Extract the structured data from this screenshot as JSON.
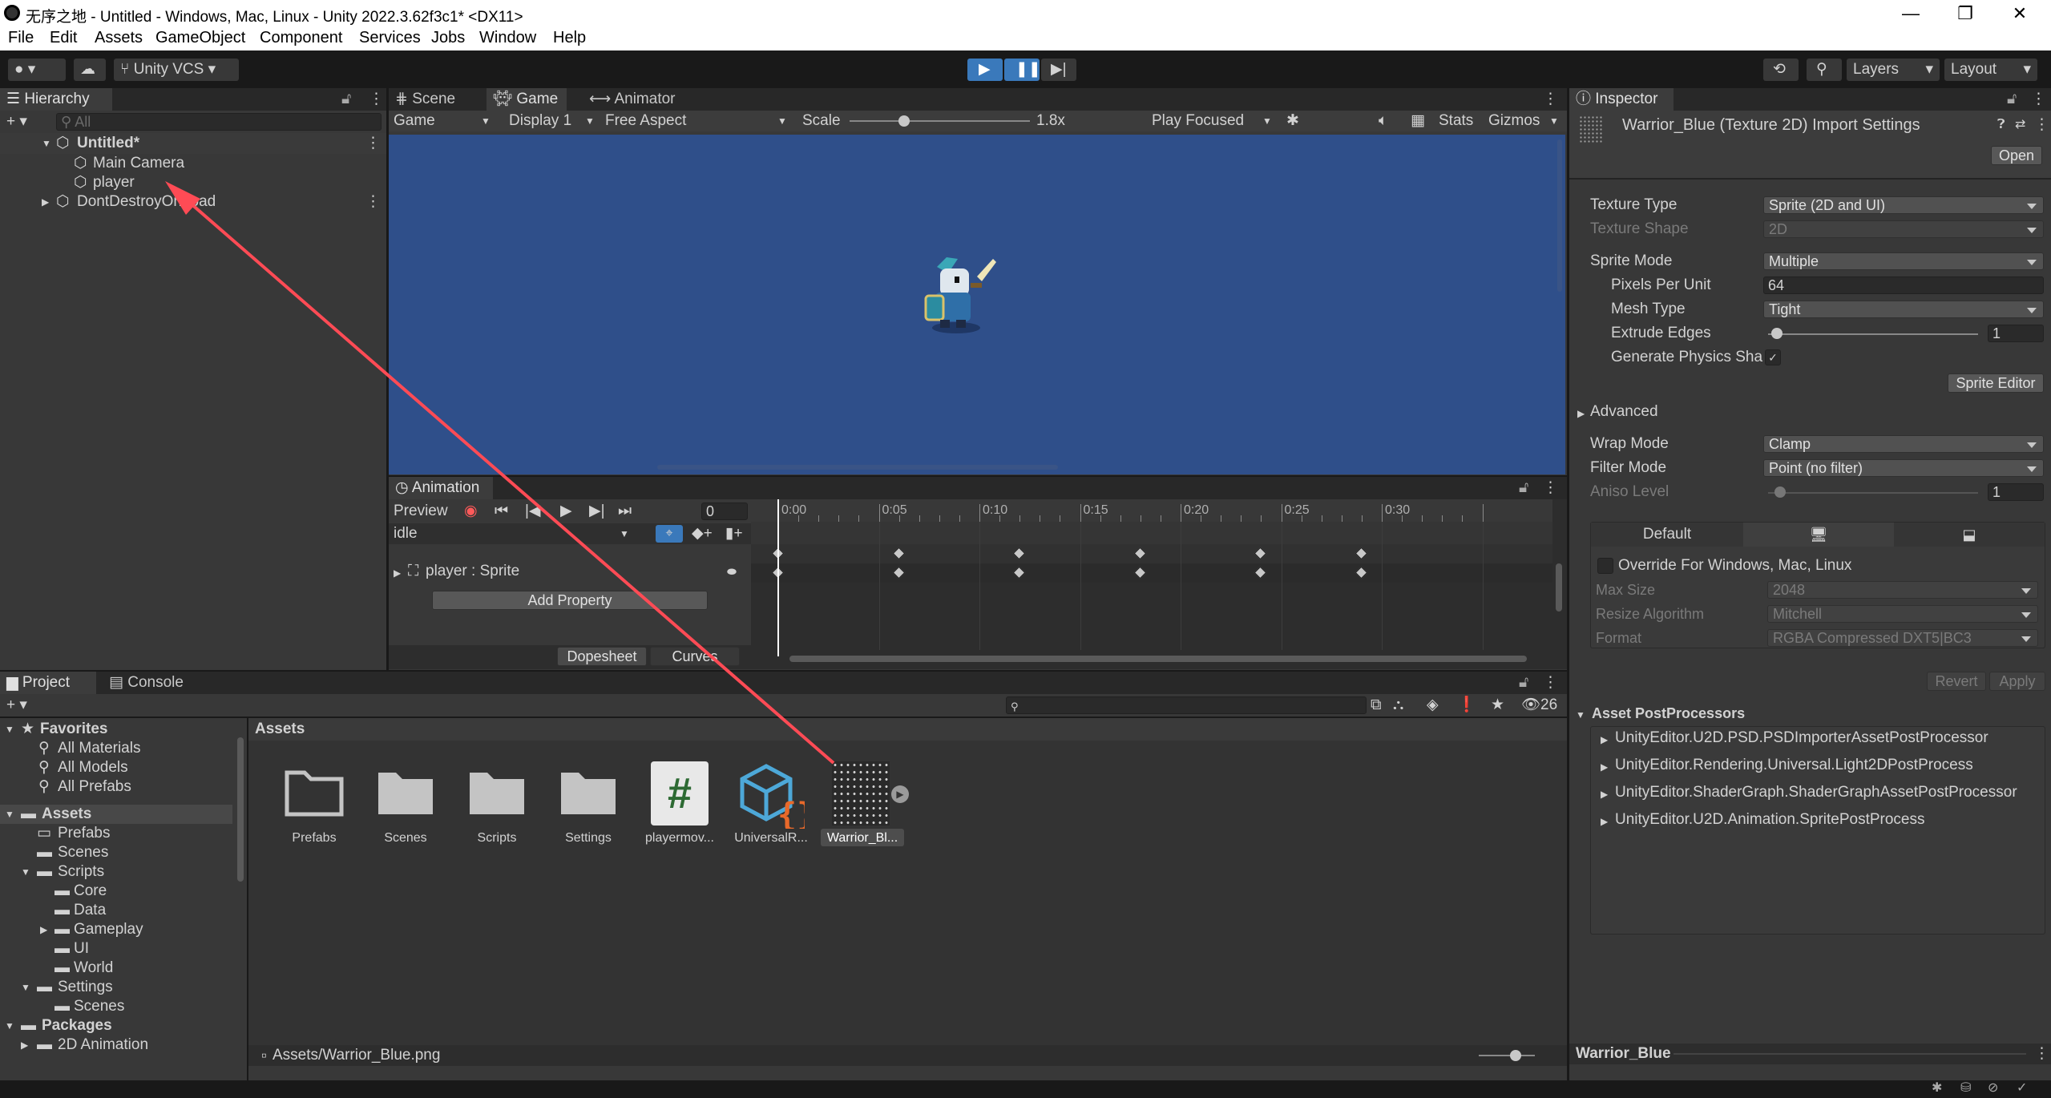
{
  "window": {
    "title": "无序之地 - Untitled - Windows, Mac, Linux - Unity 2022.3.62f3c1* <DX11>",
    "min": "—",
    "max": "❐",
    "close": "✕"
  },
  "menu": [
    "File",
    "Edit",
    "Assets",
    "GameObject",
    "Component",
    "Services",
    "Jobs",
    "Window",
    "Help"
  ],
  "toolbar": {
    "vcs": "Unity VCS",
    "layers": "Layers",
    "layout": "Layout"
  },
  "hierarchy": {
    "tab": "Hierarchy",
    "search_placeholder": "All",
    "items": [
      "Untitled*",
      "Main Camera",
      "player",
      "DontDestroyOnLoad"
    ]
  },
  "game": {
    "tabs": [
      "Scene",
      "Game",
      "Animator"
    ],
    "display_mode": "Game",
    "display": "Display 1",
    "aspect": "Free Aspect",
    "scale_label": "Scale",
    "scale_value": "1.8x",
    "scale_level": 0.3,
    "play_focused": "Play Focused",
    "stats": "Stats",
    "gizmos": "Gizmos"
  },
  "animation": {
    "tab": "Animation",
    "preview": "Preview",
    "frame": "0",
    "clip": "idle",
    "property": "player : Sprite",
    "add_property": "Add Property",
    "dopesheet": "Dopesheet",
    "curves": "Curves",
    "time_labels": [
      "0:00",
      "0:05",
      "0:10",
      "0:15",
      "0:20",
      "0:25",
      "0:30"
    ],
    "keyframes": [
      0,
      6,
      12,
      18,
      24,
      29
    ]
  },
  "project": {
    "tabs": [
      "Project",
      "Console"
    ],
    "count": "26",
    "favorites_label": "Favorites",
    "favorites": [
      "All Materials",
      "All Models",
      "All Prefabs"
    ],
    "assets_label": "Assets",
    "tree": [
      "Prefabs",
      "Scenes",
      "Scripts",
      "Core",
      "Data",
      "Gameplay",
      "UI",
      "World",
      "Settings",
      "Scenes"
    ],
    "packages_label": "Packages",
    "packages": [
      "2D Animation"
    ],
    "breadcrumb": "Assets",
    "items": [
      "Prefabs",
      "Scenes",
      "Scripts",
      "Settings",
      "playermov...",
      "UniversalR...",
      "Warrior_Bl..."
    ],
    "status_path": "Assets/Warrior_Blue.png"
  },
  "inspector": {
    "tab": "Inspector",
    "title": "Warrior_Blue (Texture 2D) Import Settings",
    "open": "Open",
    "texture_type_label": "Texture Type",
    "texture_type": "Sprite (2D and UI)",
    "texture_shape_label": "Texture Shape",
    "texture_shape": "2D",
    "sprite_mode_label": "Sprite Mode",
    "sprite_mode": "Multiple",
    "ppu_label": "Pixels Per Unit",
    "ppu": "64",
    "mesh_type_label": "Mesh Type",
    "mesh_type": "Tight",
    "extrude_label": "Extrude Edges",
    "extrude": "1",
    "physics_label": "Generate Physics Sha",
    "sprite_editor": "Sprite Editor",
    "advanced": "Advanced",
    "wrap_label": "Wrap Mode",
    "wrap": "Clamp",
    "filter_label": "Filter Mode",
    "filter": "Point (no filter)",
    "aniso_label": "Aniso Level",
    "aniso": "1",
    "platform_default": "Default",
    "override": "Override For Windows, Mac, Linux",
    "max_size_label": "Max Size",
    "max_size": "2048",
    "resize_label": "Resize Algorithm",
    "resize": "Mitchell",
    "format_label": "Format",
    "format": "RGBA Compressed DXT5|BC3",
    "revert": "Revert",
    "apply": "Apply",
    "postprocessors_label": "Asset PostProcessors",
    "postprocessors": [
      "UnityEditor.U2D.PSD.PSDImporterAssetPostProcessor",
      "UnityEditor.Rendering.Universal.Light2DPostProcess",
      "UnityEditor.ShaderGraph.ShaderGraphAssetPostProcessor",
      "UnityEditor.U2D.Animation.SpritePostProcess"
    ],
    "preview_name": "Warrior_Blue"
  },
  "colors": {
    "game_bg": "#2f4f8a",
    "accent": "#3a79bb",
    "arrow": "#ff4b55"
  }
}
